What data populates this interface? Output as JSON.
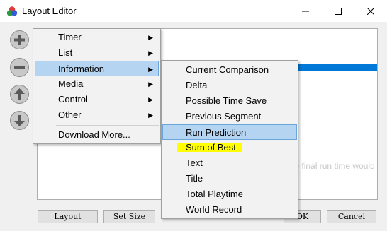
{
  "window": {
    "title": "Layout Editor"
  },
  "buttons": {
    "layout": "Layout",
    "set_size": "Set Size",
    "ok": "OK",
    "cancel": "Cancel"
  },
  "menu": {
    "items": [
      {
        "label": "Timer"
      },
      {
        "label": "List"
      },
      {
        "label": "Information"
      },
      {
        "label": "Media"
      },
      {
        "label": "Control"
      },
      {
        "label": "Other"
      },
      {
        "label": "Download More..."
      }
    ]
  },
  "submenu": {
    "items": [
      {
        "label": "Current Comparison"
      },
      {
        "label": "Delta"
      },
      {
        "label": "Possible Time Save"
      },
      {
        "label": "Previous Segment"
      },
      {
        "label": "Run Prediction"
      },
      {
        "label": "Sum of Best"
      },
      {
        "label": "Text"
      },
      {
        "label": "Title"
      },
      {
        "label": "Total Playtime"
      },
      {
        "label": "World Record"
      }
    ]
  },
  "tooltip": "Displays what the final run time would",
  "colors": {
    "selection": "#0078d7",
    "menu_highlight": "#b5d4f2",
    "annotation": "#ffff00"
  }
}
